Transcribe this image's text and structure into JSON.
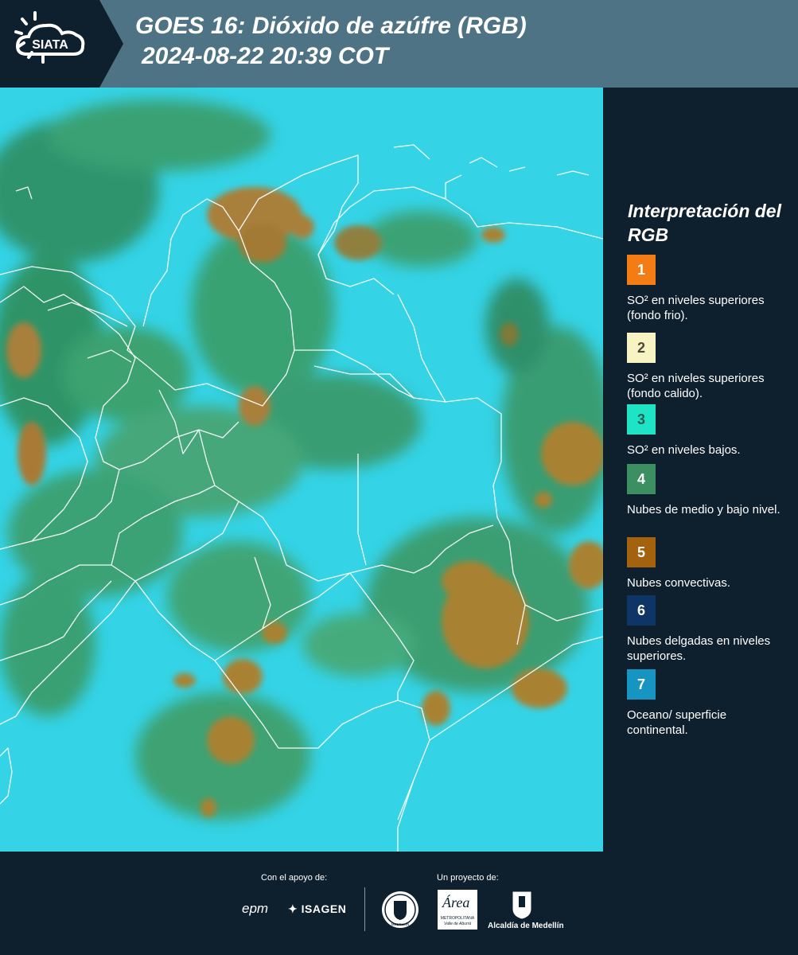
{
  "header": {
    "logo_text": "SIATA",
    "title_line1": "GOES 16: Dióxido de azúfre (RGB)",
    "title_line2": "2024-08-22 20:39 COT"
  },
  "legend": {
    "title": "Interpretación del RGB",
    "items": [
      {
        "number": "1",
        "color": "#f47c14",
        "text": "SO² en niveles superiores (fondo frio)."
      },
      {
        "number": "2",
        "color": "#f8f3c3",
        "text": "SO² en niveles superiores (fondo calido)."
      },
      {
        "number": "3",
        "color": "#1ee3c4",
        "text": "SO² en niveles bajos."
      },
      {
        "number": "4",
        "color": "#3b8f61",
        "text": "Nubes de medio y bajo nivel."
      },
      {
        "number": "5",
        "color": "#a2620e",
        "text": "Nubes convectivas."
      },
      {
        "number": "6",
        "color": "#0f3466",
        "text": "Nubes delgadas en niveles superiores."
      },
      {
        "number": "7",
        "color": "#1694c2",
        "text": "Oceano/ superficie continental."
      }
    ]
  },
  "footer": {
    "support_label": "Con el apoyo de:",
    "project_label": "Un proyecto de:",
    "sponsor_epm": "epm",
    "sponsor_isagen": "ISAGEN",
    "sponsor_medellin_seal": "MEDELLÍN",
    "sponsor_area": "Área",
    "sponsor_area_sub1": "METROPOLITANA",
    "sponsor_area_sub2": "Valle de Aburrá",
    "sponsor_alcaldia": "Alcaldía de Medellín"
  },
  "colors": {
    "header_bg": "#4e7384",
    "panel_bg": "#0e1f2d",
    "map_background": "#33d4e8",
    "low_cloud": "#3b8f61",
    "convective": "#a87a2e"
  }
}
